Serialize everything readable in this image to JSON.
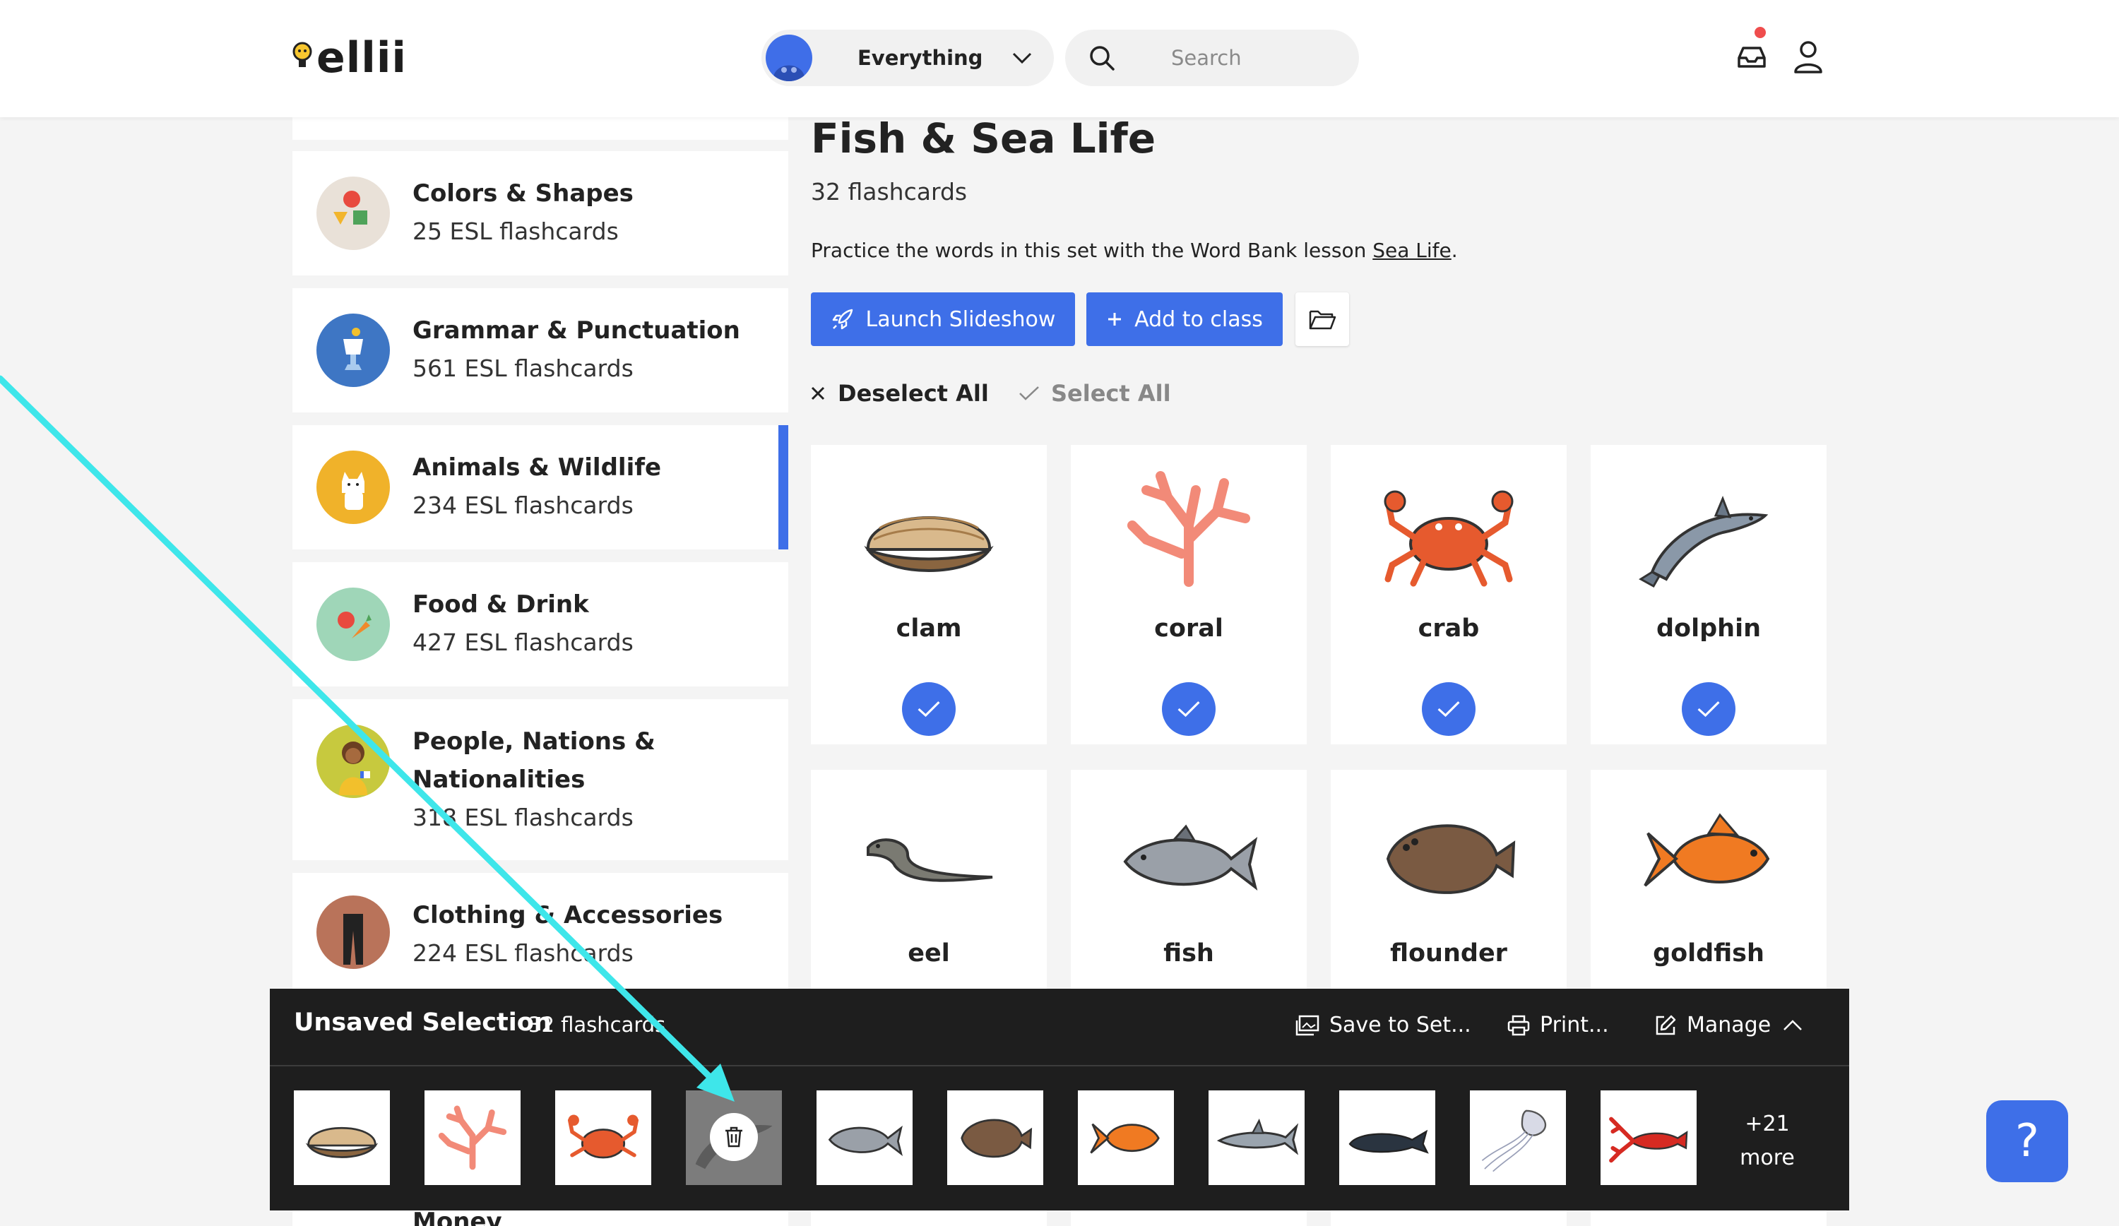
{
  "header": {
    "logo_text": "ellii",
    "scope_label": "Everything",
    "search_placeholder": "Search"
  },
  "sidebar": {
    "categories": [
      {
        "name": "Colors & Shapes",
        "count": "25 ESL flashcards"
      },
      {
        "name": "Grammar & Punctuation",
        "count": "561 ESL flashcards"
      },
      {
        "name": "Animals & Wildlife",
        "count": "234 ESL flashcards",
        "active": true
      },
      {
        "name": "Food & Drink",
        "count": "427 ESL flashcards"
      },
      {
        "name": "People, Nations &",
        "name2": "Nationalities",
        "count": "318 ESL flashcards"
      },
      {
        "name": "Clothing & Accessories",
        "count": "224 ESL flashcards"
      },
      {
        "name": "Money"
      }
    ]
  },
  "main": {
    "title": "Fish & Sea Life",
    "count": "32 flashcards",
    "practice_prefix": "Practice the words in this set with the Word Bank lesson ",
    "practice_link": "Sea Life",
    "practice_suffix": ".",
    "launch_label": "Launch Slideshow",
    "add_label": "Add to class",
    "deselect_label": "Deselect All",
    "select_label": "Select All",
    "flashcards": [
      "clam",
      "coral",
      "crab",
      "dolphin",
      "eel",
      "fish",
      "flounder",
      "goldfish"
    ]
  },
  "selection_bar": {
    "title": "Unsaved Selection",
    "count": "32 flashcards",
    "save_label": "Save to Set...",
    "print_label": "Print...",
    "manage_label": "Manage",
    "more_count": "+21",
    "more_label": "more",
    "thumbs": [
      "clam",
      "coral",
      "crab",
      "dolphin",
      "fish",
      "flounder",
      "goldfish",
      "shark",
      "whale",
      "jellyfish",
      "lobster"
    ]
  },
  "help_label": "?",
  "colors": {
    "accent": "#3e6fe8",
    "annotation_arrow": "#3ee6ea",
    "selection_bar_bg": "#1e1e1e"
  }
}
